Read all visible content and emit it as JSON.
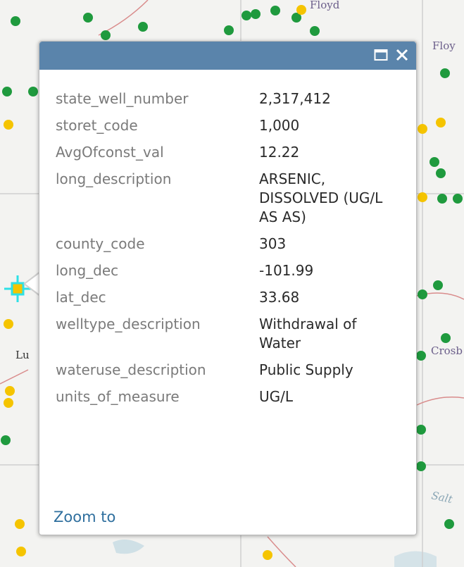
{
  "map": {
    "colors": {
      "background": "#f3f3f1",
      "well_dot_green": "#1f9a3e",
      "well_dot_yellow": "#f5c400",
      "road": "#d98c8c",
      "county_line": "#c9c9c9",
      "water": "#b8d4df",
      "selection_highlight": "#2ee0e6"
    },
    "labels": {
      "top": "Floyd",
      "right_top": "Floy",
      "left_middle": "Lu",
      "right_middle": "Crosb",
      "right_lower": "Salt"
    }
  },
  "popup": {
    "header_color": "#5a84ab",
    "maximize_icon": "maximize-icon",
    "close_icon": "close-icon",
    "attributes": [
      {
        "key": "state_well_number",
        "value": "2,317,412"
      },
      {
        "key": "storet_code",
        "value": "1,000"
      },
      {
        "key": "AvgOfconst_val",
        "value": "12.22"
      },
      {
        "key": "long_description",
        "value": "ARSENIC, DISSOLVED (UG/L AS AS)"
      },
      {
        "key": "county_code",
        "value": "303"
      },
      {
        "key": "long_dec",
        "value": "-101.99"
      },
      {
        "key": "lat_dec",
        "value": "33.68"
      },
      {
        "key": "welltype_description",
        "value": "Withdrawal of Water"
      },
      {
        "key": "wateruse_description",
        "value": "Public Supply"
      },
      {
        "key": "units_of_measure",
        "value": "UG/L"
      }
    ],
    "zoom_label": "Zoom to"
  }
}
